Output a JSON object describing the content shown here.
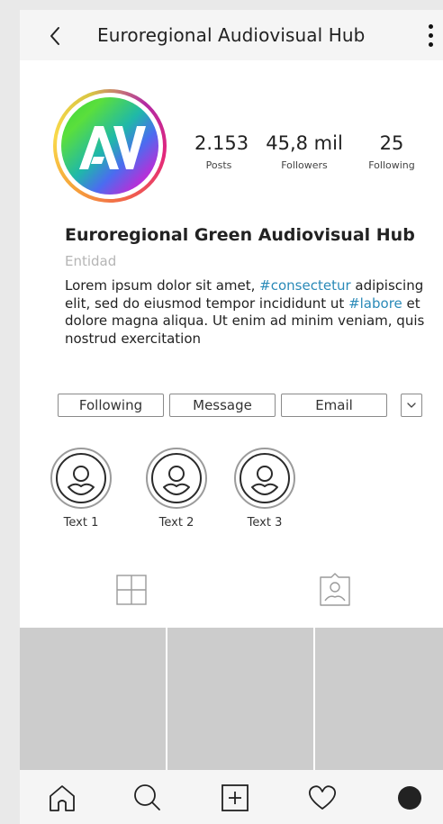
{
  "header": {
    "title": "Euroregional Audiovisual Hub",
    "back_icon": "chevron-left-icon",
    "menu_icon": "more-vertical-icon"
  },
  "profile": {
    "avatar_monogram": "AV",
    "name": "Euroregional Green Audiovisual Hub",
    "category": "Entidad",
    "bio": [
      {
        "text": "Lorem ipsum dolor sit amet, ",
        "tag": false
      },
      {
        "text": "#consectetur",
        "tag": true
      },
      {
        "text": " adipiscing elit, sed do eiusmod tempor incididunt ut ",
        "tag": false
      },
      {
        "text": "#labore",
        "tag": true
      },
      {
        "text": " et dolore magna aliqua. Ut enim ad minim veniam, quis nostrud exercitation",
        "tag": false
      }
    ]
  },
  "stats": {
    "posts": {
      "value": "2.153",
      "label": "Posts"
    },
    "followers": {
      "value": "45,8 mil",
      "label": "Followers"
    },
    "following": {
      "value": "25",
      "label": "Following"
    }
  },
  "actions": {
    "following_label": "Following",
    "message_label": "Message",
    "email_label": "Email",
    "dropdown_icon": "chevron-down-icon"
  },
  "highlights": [
    {
      "label": "Text 1",
      "icon": "user-icon"
    },
    {
      "label": "Text 2",
      "icon": "user-icon"
    },
    {
      "label": "Text 3",
      "icon": "user-icon"
    }
  ],
  "tabs": [
    {
      "icon": "grid-icon"
    },
    {
      "icon": "tagged-photo-icon"
    }
  ],
  "grid": {
    "tile_count": 3,
    "tile_color": "#cccccc"
  },
  "bottom_nav": [
    {
      "icon": "home-icon"
    },
    {
      "icon": "search-icon"
    },
    {
      "icon": "add-post-icon"
    },
    {
      "icon": "heart-icon"
    },
    {
      "icon": "profile-dot-icon"
    }
  ],
  "colors": {
    "hashtag": "#2a8ab8",
    "muted_text": "#b5b5b5",
    "bar_background": "#f5f5f5",
    "placeholder": "#cccccc"
  }
}
